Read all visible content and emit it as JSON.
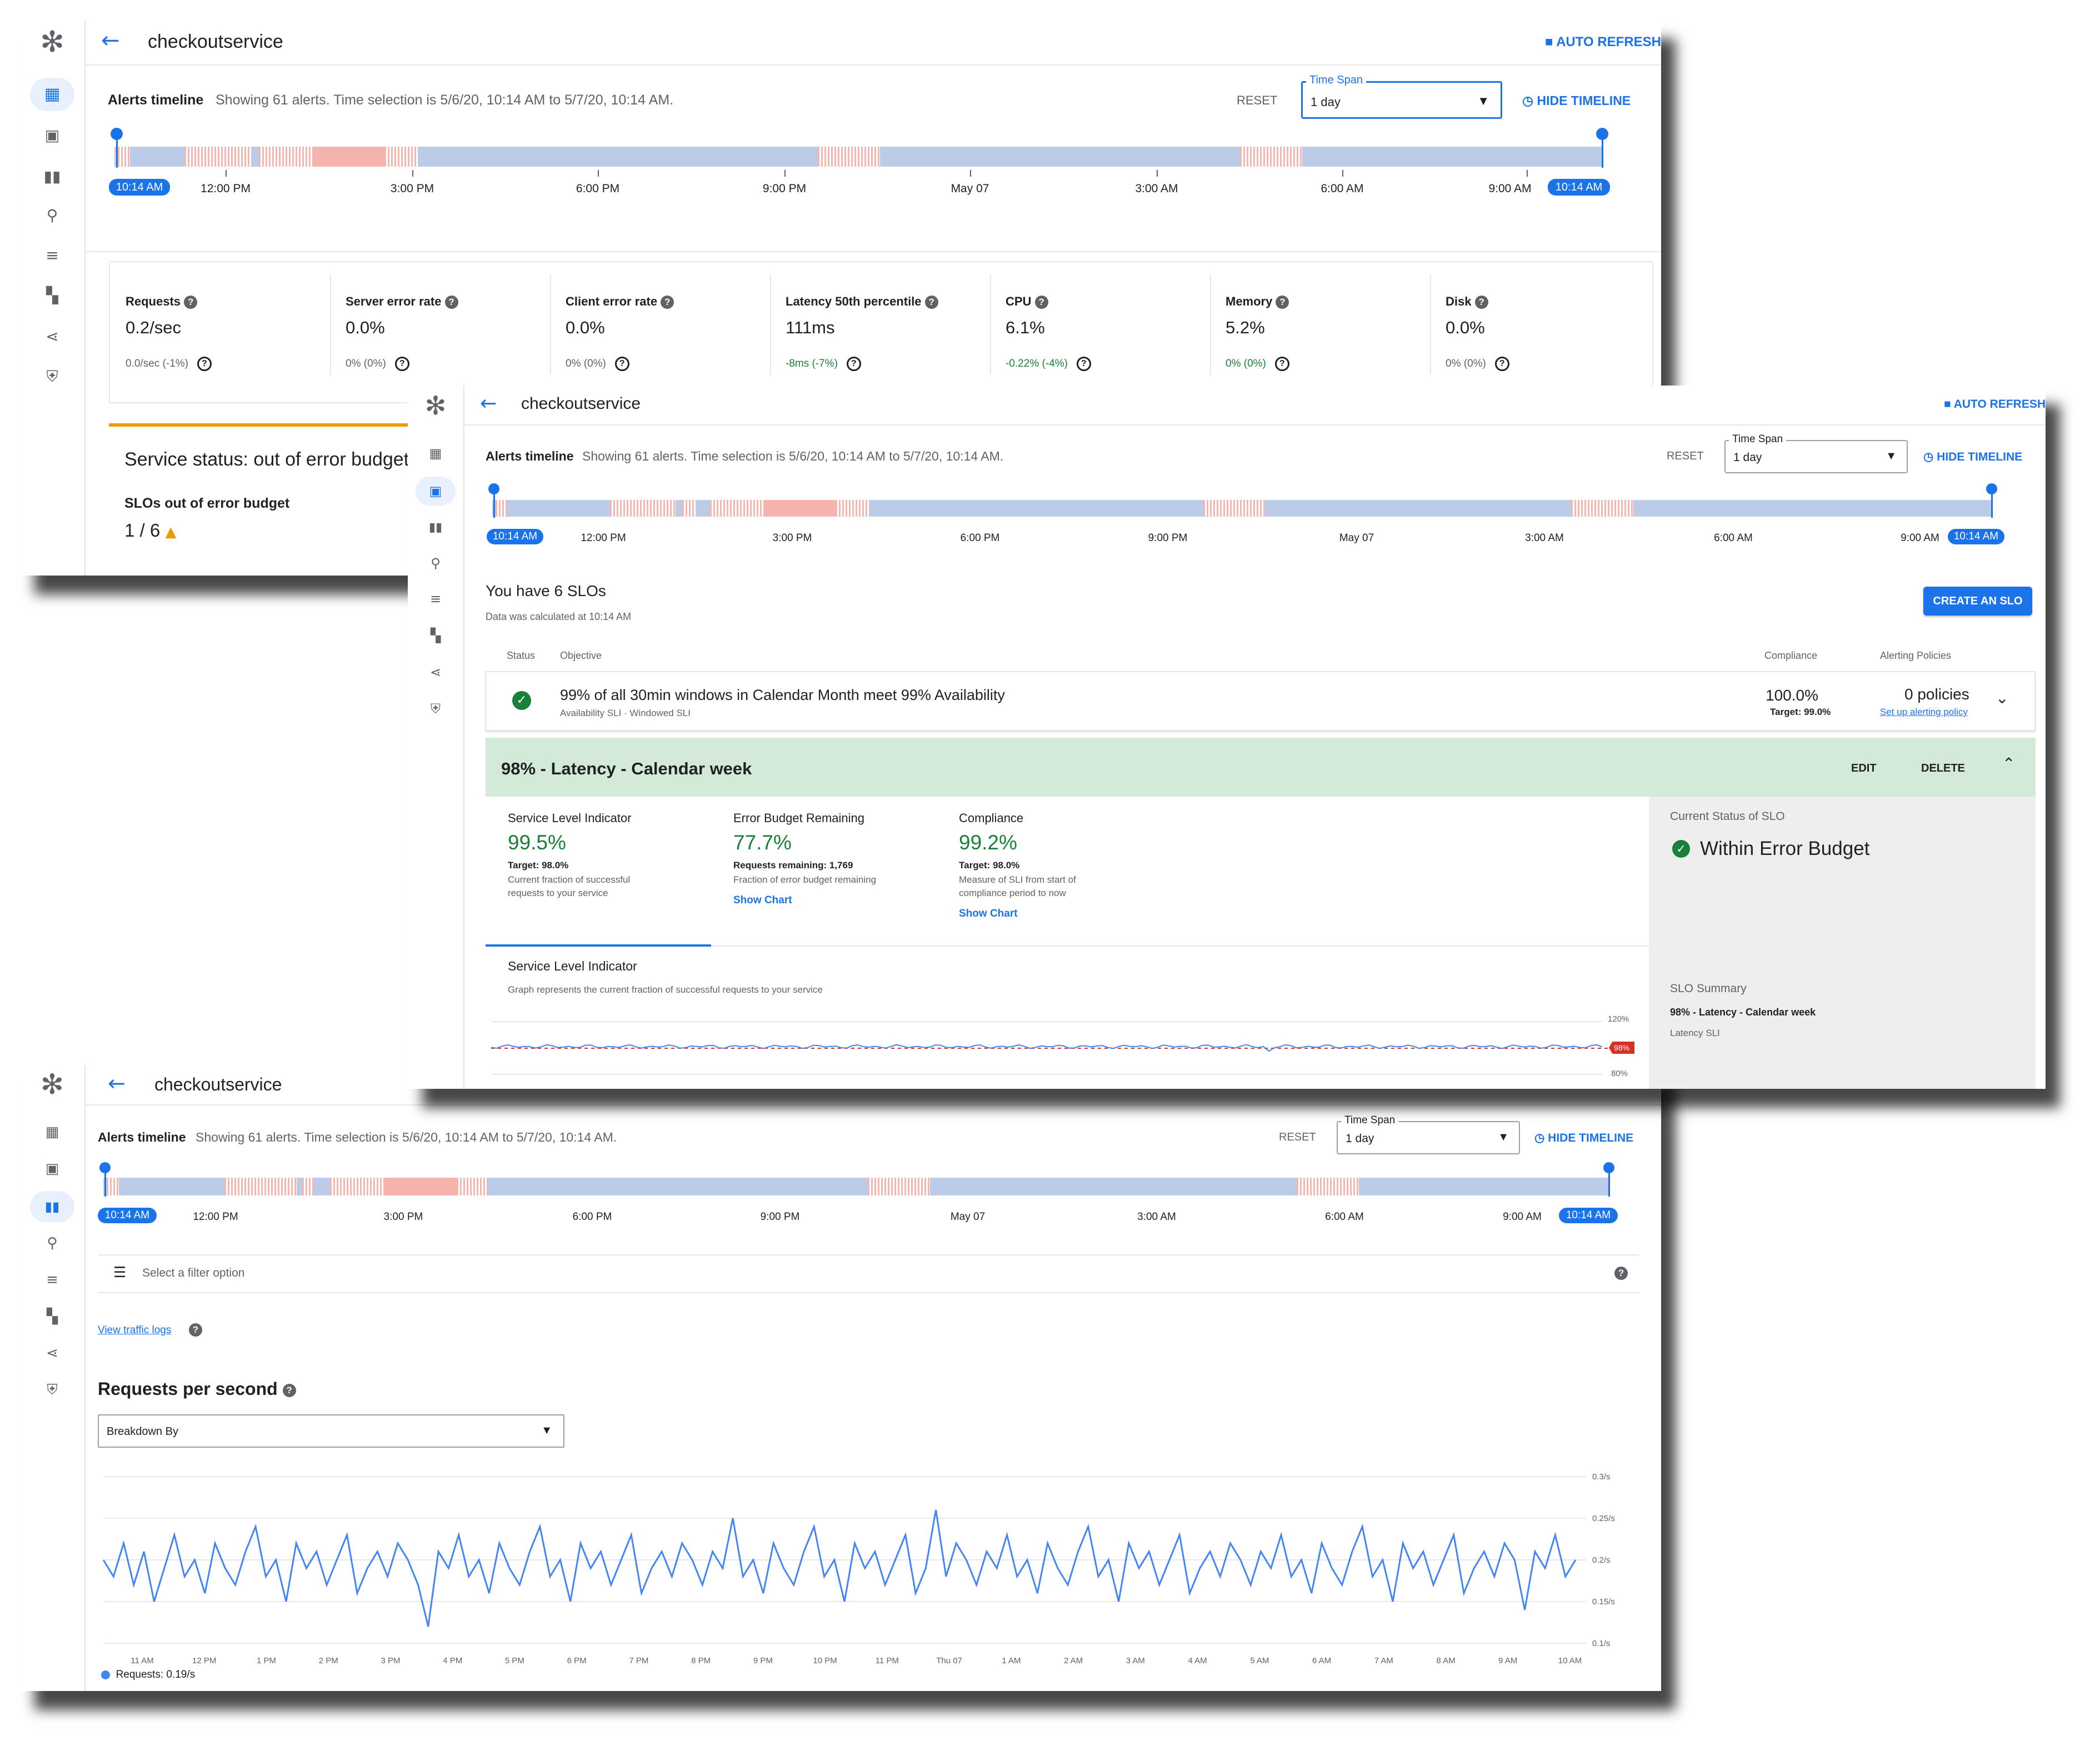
{
  "service_name": "checkoutservice",
  "auto_refresh": "AUTO REFRESH",
  "alerts": {
    "title": "Alerts timeline",
    "summary": "Showing 61 alerts. Time selection is 5/6/20, 10:14 AM to 5/7/20, 10:14 AM.",
    "reset": "RESET",
    "timespan_label": "Time Span",
    "timespan_value": "1 day",
    "hide_timeline": "HIDE TIMELINE",
    "start_chip": "10:14 AM",
    "end_chip": "10:14 AM",
    "ticks": [
      "12:00 PM",
      "3:00 PM",
      "6:00 PM",
      "9:00 PM",
      "May 07",
      "3:00 AM",
      "6:00 AM",
      "9:00 AM"
    ]
  },
  "metrics": [
    {
      "label": "Requests",
      "value": "0.2/sec",
      "delta": "0.0/sec (-1%)",
      "delta_color": "#5f6368"
    },
    {
      "label": "Server error rate",
      "value": "0.0%",
      "delta": "0% (0%)",
      "delta_color": "#5f6368"
    },
    {
      "label": "Client error rate",
      "value": "0.0%",
      "delta": "0% (0%)",
      "delta_color": "#5f6368"
    },
    {
      "label": "Latency 50th percentile",
      "value": "111ms",
      "delta": "-8ms (-7%)",
      "delta_color": "#188038"
    },
    {
      "label": "CPU",
      "value": "6.1%",
      "delta": "-0.22% (-4%)",
      "delta_color": "#188038"
    },
    {
      "label": "Memory",
      "value": "5.2%",
      "delta": "0% (0%)",
      "delta_color": "#188038"
    },
    {
      "label": "Disk",
      "value": "0.0%",
      "delta": "0% (0%)",
      "delta_color": "#5f6368"
    }
  ],
  "status": {
    "title": "Service status: out of error budget",
    "slos_label": "SLOs out of error budget",
    "slos_value": "1 / 6"
  },
  "slo": {
    "heading": "You have 6 SLOs",
    "calculated": "Data was calculated at 10:14 AM",
    "create_button": "CREATE AN SLO",
    "col_status": "Status",
    "col_objective": "Objective",
    "col_compliance": "Compliance",
    "col_alerting": "Alerting Policies",
    "row1": {
      "objective": "99% of all 30min windows in Calendar Month meet 99% Availability",
      "sub": "Availability SLI · Windowed SLI",
      "compliance": "100.0%",
      "target": "Target: 99.0%",
      "policies": "0 policies",
      "setup_link": "Set up alerting policy"
    },
    "expanded": {
      "title": "98% - Latency - Calendar week",
      "edit": "EDIT",
      "delete": "DELETE",
      "sli": {
        "label": "Service Level Indicator",
        "value": "99.5%",
        "target": "Target: 98.0%",
        "desc1": "Current fraction of successful",
        "desc2": "requests to your service"
      },
      "ebr": {
        "label": "Error Budget Remaining",
        "value": "77.7%",
        "target": "Requests remaining: 1,769",
        "desc1": "Fraction of error budget remaining",
        "link": "Show Chart"
      },
      "comp": {
        "label": "Compliance",
        "value": "99.2%",
        "target": "Target: 98.0%",
        "desc1": "Measure of SLI from start of",
        "desc2": "compliance period to now",
        "link": "Show Chart"
      },
      "current_status_label": "Current Status of SLO",
      "current_status": "Within Error Budget",
      "summary_label": "SLO Summary",
      "summary_title": "98% - Latency - Calendar week",
      "summary_sub": "Latency SLI",
      "graph_title": "Service Level Indicator",
      "graph_desc": "Graph represents the current fraction of successful requests to your service",
      "y_top": "120%",
      "y_bottom": "80%",
      "marker": "98%"
    }
  },
  "traffic": {
    "filter_placeholder": "Select a filter option",
    "view_logs": "View traffic logs",
    "chart_title": "Requests per second",
    "breakdown": "Breakdown By",
    "legend": "Requests: 0.19/s"
  },
  "chart_data": {
    "type": "line",
    "title": "Requests per second",
    "x_ticks": [
      "11 AM",
      "12 PM",
      "1 PM",
      "2 PM",
      "3 PM",
      "4 PM",
      "5 PM",
      "6 PM",
      "7 PM",
      "8 PM",
      "9 PM",
      "10 PM",
      "11 PM",
      "Thu 07",
      "1 AM",
      "2 AM",
      "3 AM",
      "4 AM",
      "5 AM",
      "6 AM",
      "7 AM",
      "8 AM",
      "9 AM",
      "10 AM"
    ],
    "y_ticks": [
      "0.3/s",
      "0.25/s",
      "0.2/s",
      "0.15/s",
      "0.1/s"
    ],
    "ylim": [
      0.1,
      0.3
    ],
    "series": [
      {
        "name": "Requests",
        "color": "#4285f4",
        "values": [
          0.2,
          0.18,
          0.22,
          0.17,
          0.21,
          0.15,
          0.19,
          0.23,
          0.18,
          0.2,
          0.16,
          0.22,
          0.19,
          0.17,
          0.21,
          0.24,
          0.18,
          0.2,
          0.15,
          0.22,
          0.19,
          0.21,
          0.17,
          0.2,
          0.23,
          0.16,
          0.19,
          0.21,
          0.18,
          0.22,
          0.2,
          0.17,
          0.12,
          0.21,
          0.19,
          0.23,
          0.18,
          0.2,
          0.16,
          0.22,
          0.19,
          0.17,
          0.21,
          0.24,
          0.18,
          0.2,
          0.15,
          0.22,
          0.19,
          0.21,
          0.17,
          0.2,
          0.23,
          0.16,
          0.19,
          0.21,
          0.18,
          0.22,
          0.2,
          0.17,
          0.21,
          0.19,
          0.25,
          0.18,
          0.2,
          0.16,
          0.22,
          0.19,
          0.17,
          0.21,
          0.24,
          0.18,
          0.2,
          0.15,
          0.22,
          0.19,
          0.21,
          0.17,
          0.2,
          0.23,
          0.16,
          0.19,
          0.26,
          0.18,
          0.22,
          0.2,
          0.17,
          0.21,
          0.19,
          0.23,
          0.18,
          0.2,
          0.16,
          0.22,
          0.19,
          0.17,
          0.21,
          0.24,
          0.18,
          0.2,
          0.15,
          0.22,
          0.19,
          0.21,
          0.17,
          0.2,
          0.23,
          0.16,
          0.19,
          0.21,
          0.18,
          0.22,
          0.2,
          0.17,
          0.21,
          0.19,
          0.23,
          0.18,
          0.2,
          0.16,
          0.22,
          0.19,
          0.17,
          0.21,
          0.24,
          0.18,
          0.2,
          0.15,
          0.22,
          0.19,
          0.21,
          0.17,
          0.2,
          0.23,
          0.16,
          0.19,
          0.21,
          0.18,
          0.22,
          0.2,
          0.14,
          0.21,
          0.19,
          0.23,
          0.18,
          0.2
        ]
      }
    ]
  }
}
